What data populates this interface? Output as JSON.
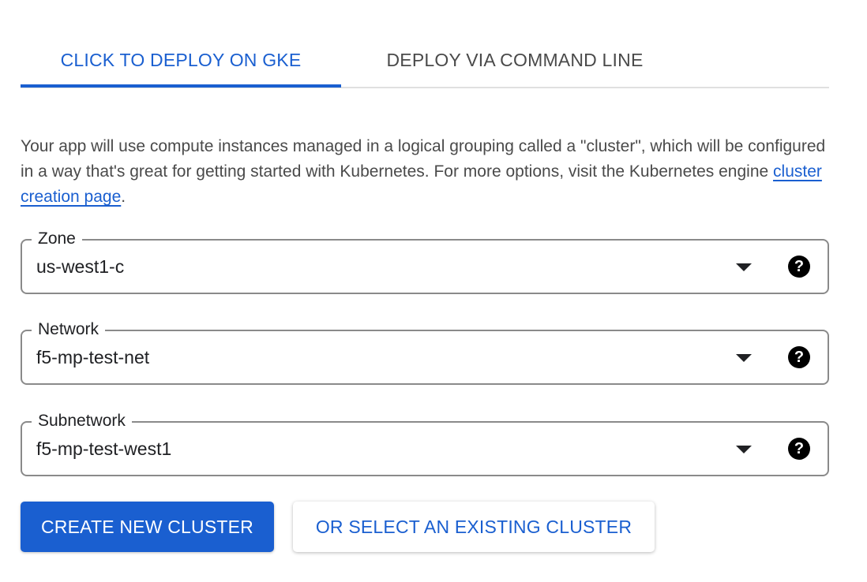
{
  "tabs": [
    {
      "label": "CLICK TO DEPLOY ON GKE",
      "active": true
    },
    {
      "label": "DEPLOY VIA COMMAND LINE",
      "active": false
    }
  ],
  "description": {
    "text_before": "Your app will use compute instances managed in a logical grouping called a \"cluster\", which will be configured in a way that's great for getting started with Kubernetes. For more options, visit the Kubernetes engine ",
    "link_text": "cluster creation page",
    "text_after": "."
  },
  "fields": {
    "zone": {
      "label": "Zone",
      "value": "us-west1-c"
    },
    "network": {
      "label": "Network",
      "value": "f5-mp-test-net"
    },
    "subnetwork": {
      "label": "Subnetwork",
      "value": "f5-mp-test-west1"
    }
  },
  "icons": {
    "dropdown": "chevron-down-icon",
    "help": "help-icon",
    "help_glyph": "?"
  },
  "buttons": {
    "create_label": "CREATE NEW CLUSTER",
    "select_label": "OR SELECT AN EXISTING CLUSTER"
  },
  "colors": {
    "accent": "#1a5fd0",
    "tab_inactive": "#4a4a4a",
    "border": "#8a8a8a"
  }
}
